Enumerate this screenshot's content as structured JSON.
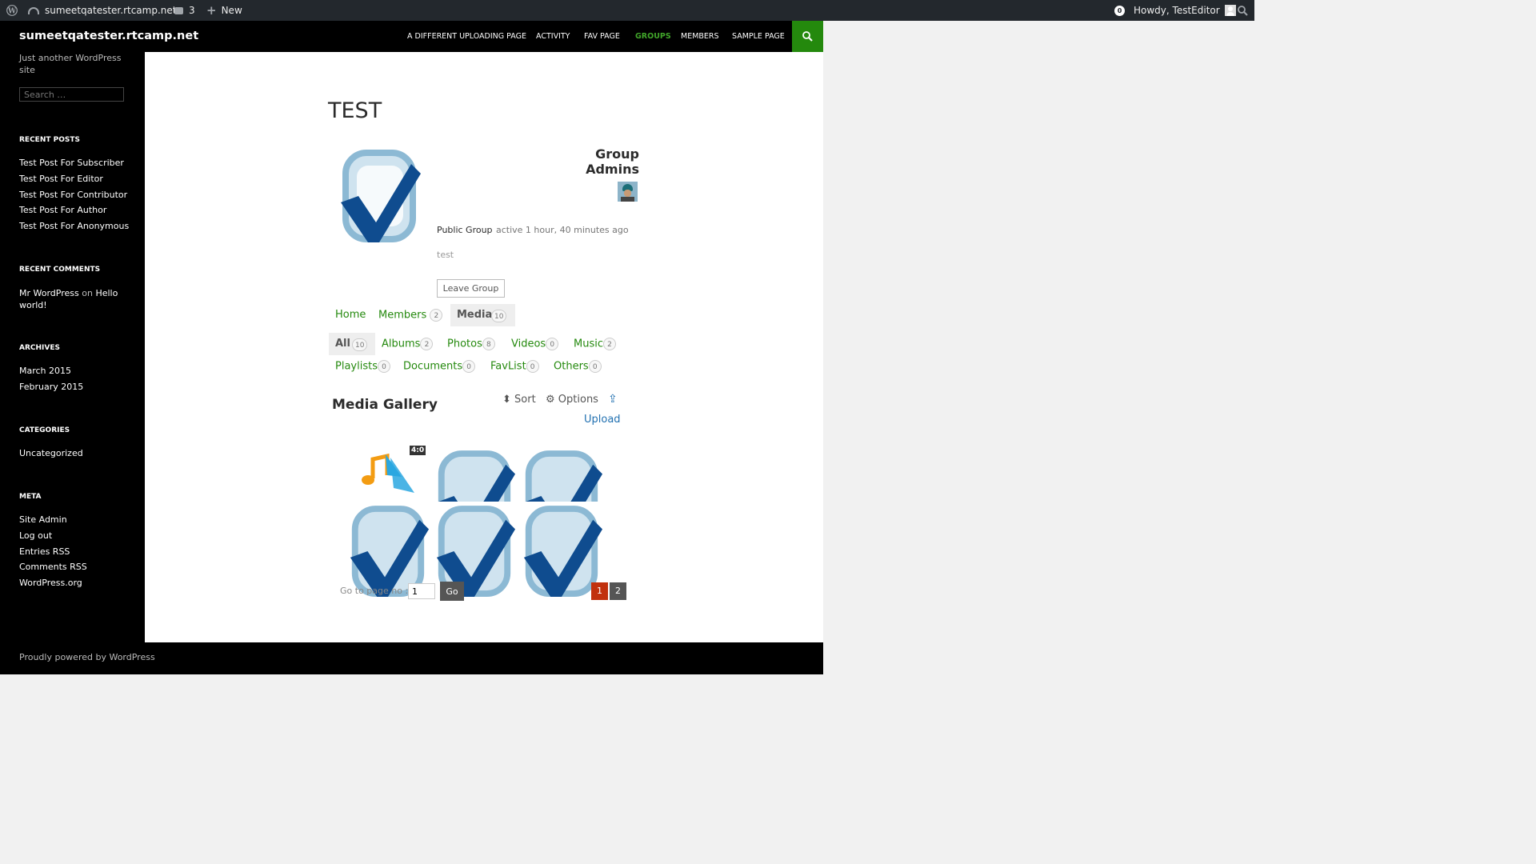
{
  "admin_bar": {
    "site_name": "sumeetqatester.rtcamp.net",
    "comments_count": "3",
    "new_label": "New",
    "notification_count": "0",
    "howdy": "Howdy, TestEditor"
  },
  "header": {
    "site_title": "sumeetqatester.rtcamp.net",
    "nav": [
      "A DIFFERENT UPLOADING PAGE",
      "ACTIVITY",
      "FAV PAGE",
      "GROUPS",
      "MEMBERS",
      "SAMPLE PAGE"
    ],
    "active_nav": "GROUPS"
  },
  "sidebar": {
    "description": "Just another WordPress site",
    "search_placeholder": "Search …",
    "recent_posts_title": "RECENT POSTS",
    "recent_posts": [
      "Test Post For Subscriber",
      "Test Post For Editor",
      "Test Post For Contributor",
      "Test Post For Author",
      "Test Post For Anonymous"
    ],
    "recent_comments_title": "RECENT COMMENTS",
    "comment_author": "Mr WordPress",
    "comment_on": "on",
    "comment_post": "Hello world!",
    "archives_title": "ARCHIVES",
    "archives": [
      "March 2015",
      "February 2015"
    ],
    "categories_title": "CATEGORIES",
    "categories": [
      "Uncategorized"
    ],
    "meta_title": "META",
    "meta": [
      "Site Admin",
      "Log out",
      "Entries RSS",
      "Comments RSS",
      "WordPress.org"
    ]
  },
  "group": {
    "title": "TEST",
    "admins_heading_1": "Group",
    "admins_heading_2": "Admins",
    "type": "Public Group",
    "activity": "active 1 hour, 40 minutes ago",
    "description": "test",
    "leave_button": "Leave Group"
  },
  "group_tabs": [
    {
      "label": "Home",
      "count": ""
    },
    {
      "label": "Members",
      "count": "2"
    },
    {
      "label": "Media",
      "count": "10"
    }
  ],
  "media_filters": [
    {
      "label": "All",
      "count": "10"
    },
    {
      "label": "Albums",
      "count": "2"
    },
    {
      "label": "Photos",
      "count": "8"
    },
    {
      "label": "Videos",
      "count": "0"
    },
    {
      "label": "Music",
      "count": "2"
    },
    {
      "label": "Playlists",
      "count": "0"
    },
    {
      "label": "Documents",
      "count": "0"
    },
    {
      "label": "FavList",
      "count": "0"
    },
    {
      "label": "Others",
      "count": "0"
    }
  ],
  "gallery": {
    "title": "Media Gallery",
    "sort_label": "Sort",
    "options_label": "Options",
    "upload_label": "Upload",
    "duration_badge": "4:0",
    "goto_label": "Go to page no :",
    "goto_value": "1",
    "go_button": "Go",
    "pages": [
      "1",
      "2"
    ],
    "current_page": "1"
  },
  "footer": {
    "text": "Proudly powered by WordPress"
  },
  "colors": {
    "accent": "#24890d",
    "admin_bar": "#23282d",
    "link_blue": "#2271b1",
    "pagination_active": "#c1310e"
  }
}
